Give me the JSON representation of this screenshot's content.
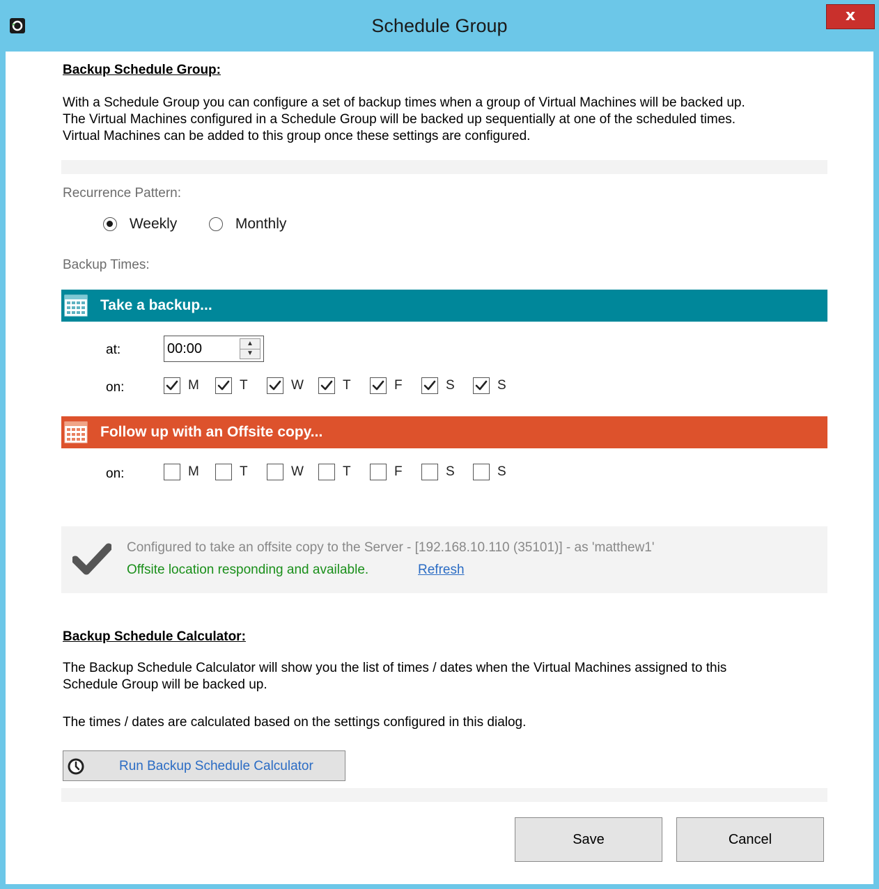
{
  "window": {
    "title": "Schedule Group",
    "close_label": "x"
  },
  "intro": {
    "heading": "Backup Schedule Group:",
    "lines": [
      "With a Schedule Group you can configure a set of backup times when a group of Virtual Machines will be backed up.",
      "The Virtual Machines configured in a Schedule Group will be backed up sequentially at one of the scheduled times.",
      "Virtual Machines can be added to this group once these settings are configured."
    ]
  },
  "recurrence": {
    "label": "Recurrence Pattern:",
    "options": [
      {
        "label": "Weekly",
        "checked": true
      },
      {
        "label": "Monthly",
        "checked": false
      }
    ]
  },
  "backup_times": {
    "label": "Backup Times:",
    "band_label": "Take a backup...",
    "at_label": "at:",
    "time_value": "00:00",
    "on_label": "on:",
    "days": [
      {
        "label": "M",
        "checked": true
      },
      {
        "label": "T",
        "checked": true
      },
      {
        "label": "W",
        "checked": true
      },
      {
        "label": "T",
        "checked": true
      },
      {
        "label": "F",
        "checked": true
      },
      {
        "label": "S",
        "checked": true
      },
      {
        "label": "S",
        "checked": true
      }
    ]
  },
  "offsite": {
    "band_label": "Follow up with an Offsite copy...",
    "on_label": "on:",
    "days": [
      {
        "label": "M",
        "checked": false
      },
      {
        "label": "T",
        "checked": false
      },
      {
        "label": "W",
        "checked": false
      },
      {
        "label": "T",
        "checked": false
      },
      {
        "label": "F",
        "checked": false
      },
      {
        "label": "S",
        "checked": false
      },
      {
        "label": "S",
        "checked": false
      }
    ],
    "config_text": "Configured to take an offsite copy to the Server - [192.168.10.110 (35101)] - as 'matthew1'",
    "status_text": "Offsite location responding and available.",
    "refresh_label": "Refresh"
  },
  "calculator": {
    "heading": "Backup Schedule Calculator:",
    "lines": [
      "The Backup Schedule Calculator will show you the list of times / dates when the Virtual Machines assigned to this",
      "Schedule Group will be backed up."
    ],
    "note": "The times / dates are calculated based on the settings configured in this dialog.",
    "button_label": "Run Backup Schedule Calculator"
  },
  "footer": {
    "save_label": "Save",
    "cancel_label": "Cancel"
  },
  "colors": {
    "titlebar": "#6cc7e8",
    "backup_band": "#00879a",
    "offsite_band": "#dd522c",
    "status_green": "#1a8f1a",
    "link_blue": "#2b6cc4"
  }
}
